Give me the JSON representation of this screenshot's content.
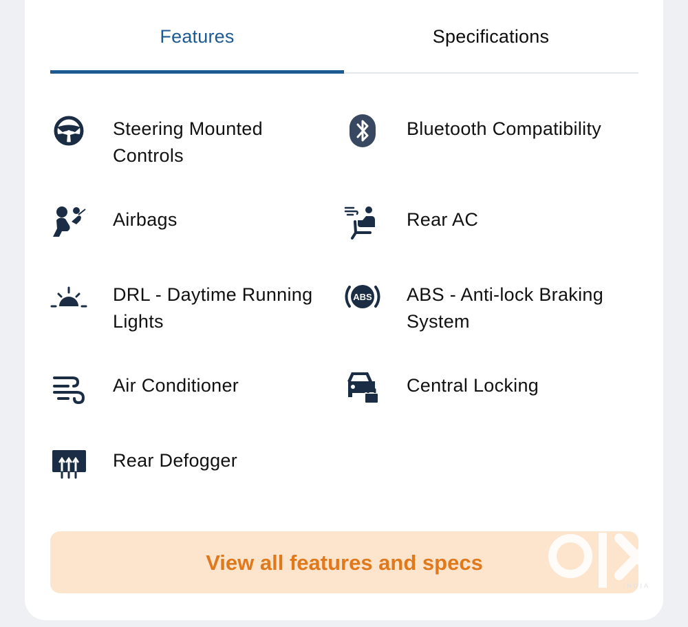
{
  "tabs": {
    "features": "Features",
    "specifications": "Specifications"
  },
  "features": [
    {
      "label_line1": "Steering Mounted",
      "label_line2": "Controls",
      "icon": "steering-wheel-icon"
    },
    {
      "label_line1": "Bluetooth Compatibility",
      "label_line2": "",
      "icon": "bluetooth-icon"
    },
    {
      "label_line1": "Airbags",
      "label_line2": "",
      "icon": "airbag-icon"
    },
    {
      "label_line1": "Rear AC",
      "label_line2": "",
      "icon": "rear-ac-icon"
    },
    {
      "label_line1": "DRL - Daytime Running",
      "label_line2": "Lights",
      "icon": "sunrise-icon"
    },
    {
      "label_line1": "ABS - Anti-lock Braking",
      "label_line2": "System",
      "icon": "abs-icon"
    },
    {
      "label_line1": "Air Conditioner",
      "label_line2": "",
      "icon": "air-flow-icon"
    },
    {
      "label_line1": "Central Locking",
      "label_line2": "",
      "icon": "car-lock-icon"
    },
    {
      "label_line1": "Rear Defogger",
      "label_line2": "",
      "icon": "rear-defogger-icon"
    }
  ],
  "icons": {
    "abs_text": "ABS"
  },
  "cta": {
    "label": "View all features and specs"
  },
  "watermark": {
    "logo": "olx",
    "text": "INDIA"
  },
  "colors": {
    "accent": "#1d5a92",
    "icon": "#1a2d44",
    "cta_bg": "#fde4cd",
    "cta_text": "#e0791c",
    "background": "#eef0f3"
  }
}
